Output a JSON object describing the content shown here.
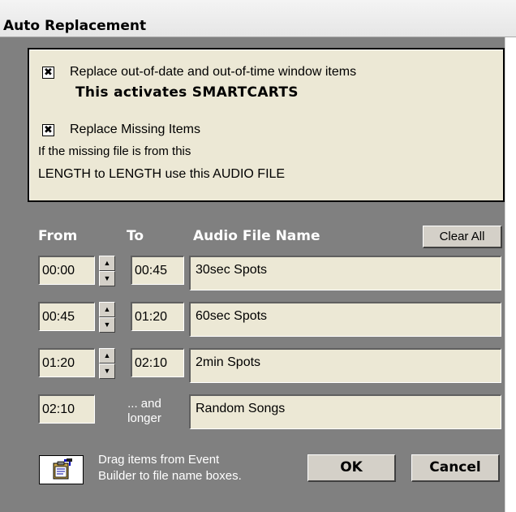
{
  "window": {
    "title": "Auto Replacement"
  },
  "options": {
    "replace_outdated": {
      "checked": true,
      "check_glyph": "✖",
      "label": "Replace out-of-date and out-of-time window items",
      "note": "This activates SMARTCARTS"
    },
    "replace_missing": {
      "checked": true,
      "check_glyph": "✖",
      "label": "Replace Missing Items",
      "desc_line1": "If the missing file is from this",
      "desc_line2": "LENGTH to LENGTH use this AUDIO FILE"
    }
  },
  "table": {
    "headers": {
      "from": "From",
      "to": "To",
      "audio": "Audio File Name"
    },
    "clear_all": "Clear All",
    "rows": [
      {
        "from": "00:00",
        "to": "00:45",
        "file": "30sec Spots"
      },
      {
        "from": "00:45",
        "to": "01:20",
        "file": "60sec Spots"
      },
      {
        "from": "01:20",
        "to": "02:10",
        "file": "2min Spots"
      },
      {
        "from": "02:10",
        "to_line1": "... and",
        "to_line2": "longer",
        "file": "Random Songs"
      }
    ],
    "spinner": {
      "up_glyph": "▲",
      "down_glyph": "▼"
    }
  },
  "footer": {
    "icon": "clipboard-icon",
    "help_line1": "Drag items from Event",
    "help_line2": "Builder to file name boxes.",
    "ok": "OK",
    "cancel": "Cancel"
  }
}
